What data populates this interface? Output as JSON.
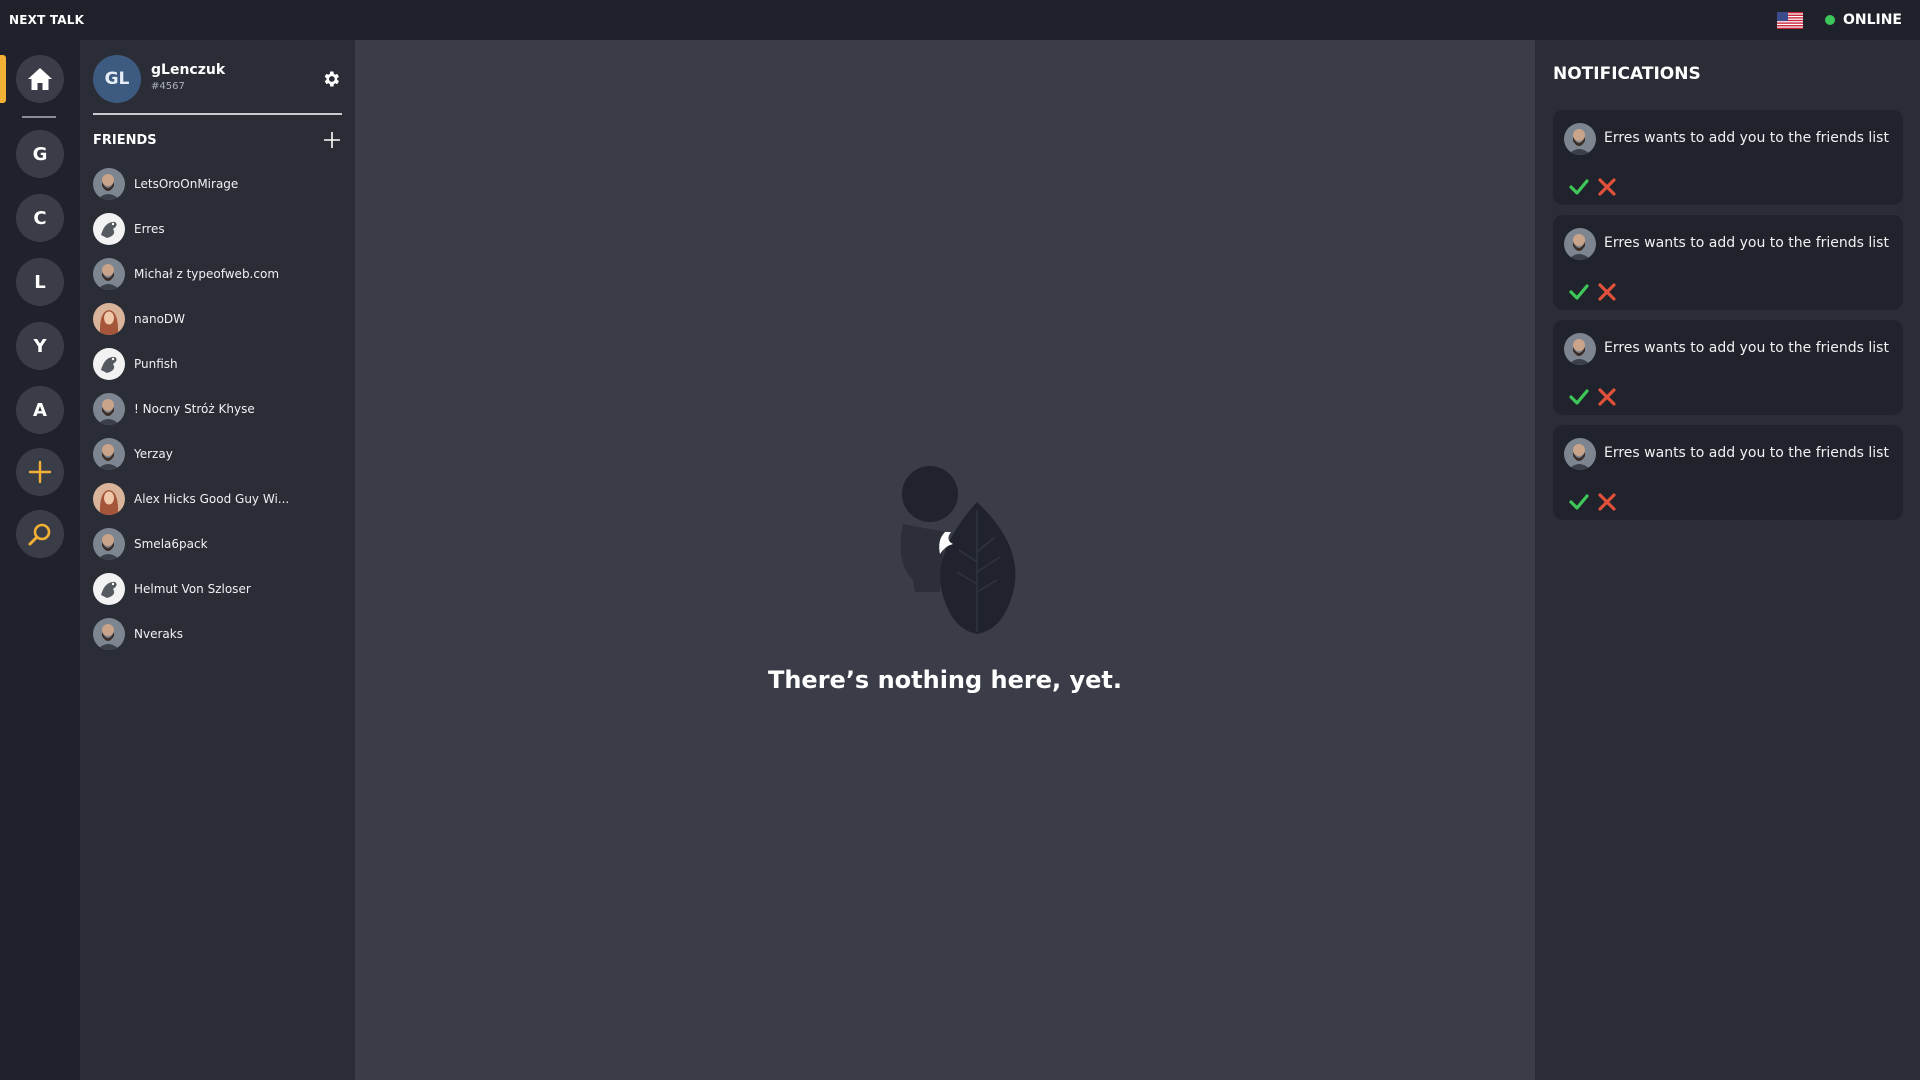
{
  "app": {
    "title": "NEXT TALK"
  },
  "topbar": {
    "status_label": "ONLINE",
    "language_icon": "us-flag-icon",
    "status_color": "#3cc85a"
  },
  "colors": {
    "accent": "#f2b134",
    "accept": "#3ec85a",
    "decline": "#e0503a"
  },
  "rail": {
    "servers": [
      {
        "letter": "G"
      },
      {
        "letter": "C"
      },
      {
        "letter": "L"
      },
      {
        "letter": "Y"
      },
      {
        "letter": "A"
      }
    ],
    "home_icon": "home-icon",
    "add_icon": "plus-icon",
    "search_icon": "search-icon"
  },
  "profile": {
    "initials": "GL",
    "username": "gLenczuk",
    "tag": "#4567"
  },
  "friends": {
    "title": "FRIENDS",
    "items": [
      {
        "name": "LetsOroOnMirage",
        "avatar": "bearded-man"
      },
      {
        "name": "Erres",
        "avatar": "bird"
      },
      {
        "name": "Michał z typeofweb.com",
        "avatar": "bearded-man"
      },
      {
        "name": "nanoDW",
        "avatar": "woman"
      },
      {
        "name": "Punfish",
        "avatar": "bird"
      },
      {
        "name": "! Nocny Stróż Khyse",
        "avatar": "bearded-man"
      },
      {
        "name": "Yerzay",
        "avatar": "bearded-man"
      },
      {
        "name": "Alex Hicks Good Guy Wi...",
        "avatar": "woman"
      },
      {
        "name": "Smela6pack",
        "avatar": "bearded-man"
      },
      {
        "name": "Helmut Von Szloser",
        "avatar": "bird"
      },
      {
        "name": "Nveraks",
        "avatar": "bearded-man"
      }
    ]
  },
  "main": {
    "empty_message": "There’s nothing here, yet."
  },
  "notifications": {
    "title": "NOTIFICATIONS",
    "items": [
      {
        "text": "Erres wants to add you to the friends list"
      },
      {
        "text": "Erres wants to add you to the friends list"
      },
      {
        "text": "Erres wants to add you to the friends list"
      },
      {
        "text": "Erres wants to add you to the friends list"
      }
    ]
  }
}
